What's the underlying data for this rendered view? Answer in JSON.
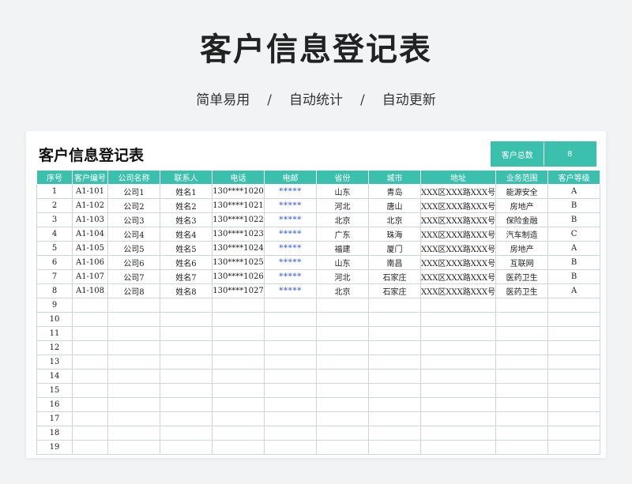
{
  "page": {
    "title": "客户信息登记表",
    "features": [
      "简单易用",
      "自动统计",
      "自动更新"
    ],
    "separator": "/"
  },
  "sheet": {
    "title": "客户信息登记表",
    "total_label": "客户总数",
    "total_value": "8",
    "columns": [
      "序号",
      "客户编号",
      "公司名称",
      "联系人",
      "电话",
      "电邮",
      "省份",
      "城市",
      "地址",
      "业务范围",
      "客户等级"
    ],
    "rows": [
      [
        "1",
        "A1-101",
        "公司1",
        "姓名1",
        "130****1020",
        "*****",
        "山东",
        "青岛",
        "XXX区XXX路XXX号",
        "能源安全",
        "A"
      ],
      [
        "2",
        "A1-102",
        "公司2",
        "姓名2",
        "130****1021",
        "*****",
        "河北",
        "唐山",
        "XXX区XXX路XXX号",
        "房地产",
        "B"
      ],
      [
        "3",
        "A1-103",
        "公司3",
        "姓名3",
        "130****1022",
        "*****",
        "北京",
        "北京",
        "XXX区XXX路XXX号",
        "保险金融",
        "B"
      ],
      [
        "4",
        "A1-104",
        "公司4",
        "姓名4",
        "130****1023",
        "*****",
        "广东",
        "珠海",
        "XXX区XXX路XXX号",
        "汽车制造",
        "C"
      ],
      [
        "5",
        "A1-105",
        "公司5",
        "姓名5",
        "130****1024",
        "*****",
        "福建",
        "厦门",
        "XXX区XXX路XXX号",
        "房地产",
        "A"
      ],
      [
        "6",
        "A1-106",
        "公司6",
        "姓名6",
        "130****1025",
        "*****",
        "山东",
        "南昌",
        "XXX区XXX路XXX号",
        "互联网",
        "B"
      ],
      [
        "7",
        "A1-107",
        "公司7",
        "姓名7",
        "130****1026",
        "*****",
        "河北",
        "石家庄",
        "XXX区XXX路XXX号",
        "医药卫生",
        "B"
      ],
      [
        "8",
        "A1-108",
        "公司8",
        "姓名8",
        "130****1027",
        "*****",
        "北京",
        "石家庄",
        "XXX区XXX路XXX号",
        "医药卫生",
        "A"
      ],
      [
        "9",
        "",
        "",
        "",
        "",
        "",
        "",
        "",
        "",
        "",
        ""
      ],
      [
        "10",
        "",
        "",
        "",
        "",
        "",
        "",
        "",
        "",
        "",
        ""
      ],
      [
        "11",
        "",
        "",
        "",
        "",
        "",
        "",
        "",
        "",
        "",
        ""
      ],
      [
        "12",
        "",
        "",
        "",
        "",
        "",
        "",
        "",
        "",
        "",
        ""
      ],
      [
        "13",
        "",
        "",
        "",
        "",
        "",
        "",
        "",
        "",
        "",
        ""
      ],
      [
        "14",
        "",
        "",
        "",
        "",
        "",
        "",
        "",
        "",
        "",
        ""
      ],
      [
        "15",
        "",
        "",
        "",
        "",
        "",
        "",
        "",
        "",
        "",
        ""
      ],
      [
        "16",
        "",
        "",
        "",
        "",
        "",
        "",
        "",
        "",
        "",
        ""
      ],
      [
        "17",
        "",
        "",
        "",
        "",
        "",
        "",
        "",
        "",
        "",
        ""
      ],
      [
        "18",
        "",
        "",
        "",
        "",
        "",
        "",
        "",
        "",
        "",
        ""
      ],
      [
        "19",
        "",
        "",
        "",
        "",
        "",
        "",
        "",
        "",
        "",
        ""
      ]
    ]
  },
  "colors": {
    "accent": "#3cc0ae",
    "email": "#4a6de0",
    "background": "#f1f3f5"
  }
}
